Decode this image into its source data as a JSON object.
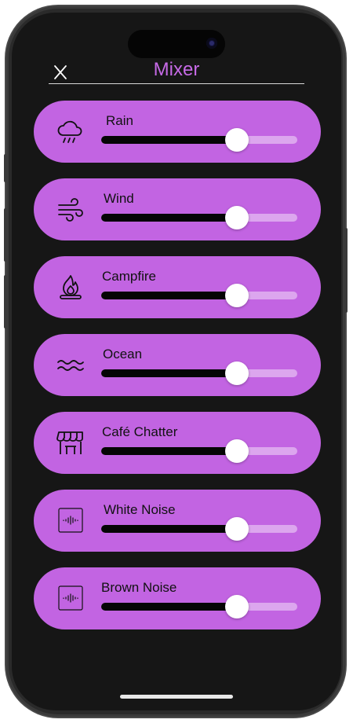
{
  "header": {
    "title": "Mixer",
    "title_color": "#c66ae6"
  },
  "theme": {
    "card_color": "#c264e2",
    "track_color": "#dca6ee",
    "fill_color": "#050505",
    "background": "#161616"
  },
  "channels": [
    {
      "label": "Rain",
      "icon": "rain-cloud-icon",
      "volume": 0.69
    },
    {
      "label": "Wind",
      "icon": "wind-icon",
      "volume": 0.69
    },
    {
      "label": "Campfire",
      "icon": "campfire-icon",
      "volume": 0.69
    },
    {
      "label": "Ocean",
      "icon": "ocean-waves-icon",
      "volume": 0.69
    },
    {
      "label": "Café Chatter",
      "icon": "cafe-storefront-icon",
      "volume": 0.69
    },
    {
      "label": "White Noise",
      "icon": "white-noise-waveform-icon",
      "volume": 0.69
    },
    {
      "label": "Brown Noise",
      "icon": "brown-noise-waveform-icon",
      "volume": 0.69
    }
  ]
}
